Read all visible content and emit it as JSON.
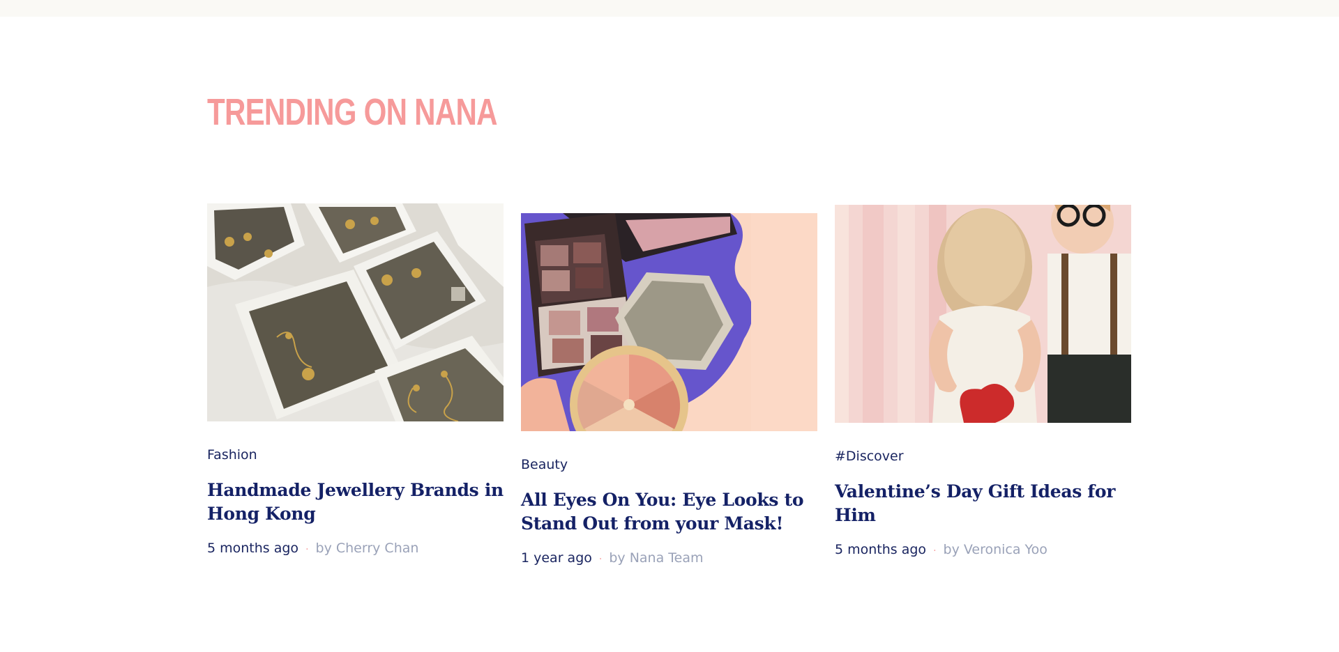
{
  "section": {
    "title": "TRENDING ON NANA"
  },
  "articles": [
    {
      "category": "Fashion",
      "title": "Handmade Jewellery Brands in Hong Kong",
      "time_ago": "5 months ago",
      "separator": "·",
      "author": "by Cherry Chan",
      "image_subject": "jewellery-boxes"
    },
    {
      "category": "Beauty",
      "title": "All Eyes On You: Eye Looks to Stand Out from your Mask!",
      "time_ago": "1 year ago",
      "separator": "·",
      "author": "by Nana Team",
      "image_subject": "eyeshadow-palettes"
    },
    {
      "category": "#Discover",
      "title": "Valentine’s Day Gift Ideas for Him",
      "time_ago": "5 months ago",
      "separator": "·",
      "author": "by Veronica Yoo",
      "image_subject": "children-valentine"
    }
  ],
  "colors": {
    "title_pink": "#f69a9a",
    "navy": "#142166",
    "muted": "#9aa2b8",
    "top_strip": "#faf9f5"
  }
}
